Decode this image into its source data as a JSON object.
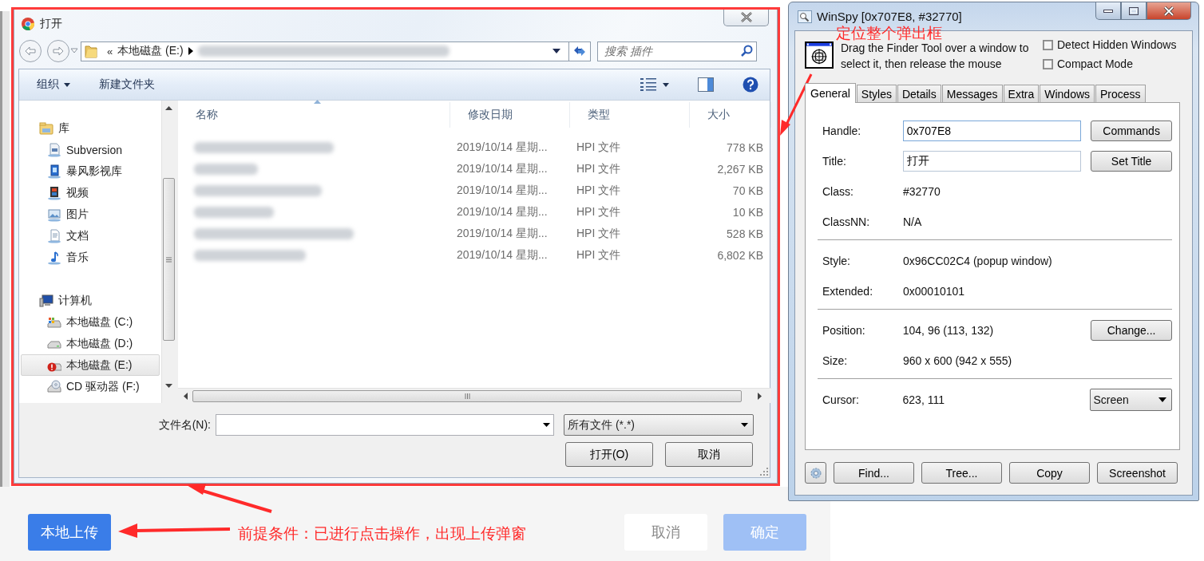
{
  "page": {
    "upload_button": "本地上传",
    "buttons": [
      {
        "label": "取消",
        "kind": "secondary",
        "disabled": false
      },
      {
        "label": "确定",
        "kind": "primary",
        "disabled": true
      }
    ]
  },
  "open_dialog": {
    "title": "打开",
    "address": {
      "prefix": "«",
      "location": "本地磁盘 (E:)"
    },
    "search": {
      "placeholder": "搜索 插件"
    },
    "toolbar": [
      {
        "label": "组织",
        "kind": "menu"
      },
      {
        "label": "新建文件夹",
        "kind": "button"
      }
    ],
    "nav_tree": [
      {
        "label": "库",
        "kind": "library",
        "selected": false,
        "children": [
          {
            "label": "Subversion",
            "kind": "svn",
            "selected": false
          },
          {
            "label": "暴风影视库",
            "kind": "media",
            "selected": false
          },
          {
            "label": "视频",
            "kind": "video",
            "selected": false
          },
          {
            "label": "图片",
            "kind": "pictures",
            "selected": false
          },
          {
            "label": "文档",
            "kind": "documents",
            "selected": false
          },
          {
            "label": "音乐",
            "kind": "music",
            "selected": false
          }
        ]
      },
      {
        "label": "计算机",
        "kind": "computer",
        "selected": false,
        "children": [
          {
            "label": "本地磁盘 (C:)",
            "kind": "drive-os",
            "selected": false
          },
          {
            "label": "本地磁盘 (D:)",
            "kind": "drive",
            "selected": false
          },
          {
            "label": "本地磁盘 (E:)",
            "kind": "drive-warning",
            "selected": true
          },
          {
            "label": "CD 驱动器 (F:)",
            "kind": "cd",
            "selected": false
          }
        ]
      }
    ],
    "columns": [
      {
        "label": "名称",
        "sorted": true
      },
      {
        "label": "修改日期",
        "sorted": false
      },
      {
        "label": "类型",
        "sorted": false
      },
      {
        "label": "大小",
        "sorted": false
      }
    ],
    "files": [
      {
        "date": "2019/10/14 星期...",
        "type": "HPI 文件",
        "size": "778 KB"
      },
      {
        "date": "2019/10/14 星期...",
        "type": "HPI 文件",
        "size": "2,267 KB"
      },
      {
        "date": "2019/10/14 星期...",
        "type": "HPI 文件",
        "size": "70 KB"
      },
      {
        "date": "2019/10/14 星期...",
        "type": "HPI 文件",
        "size": "10 KB"
      },
      {
        "date": "2019/10/14 星期...",
        "type": "HPI 文件",
        "size": "528 KB"
      },
      {
        "date": "2019/10/14 星期...",
        "type": "HPI 文件",
        "size": "6,802 KB"
      }
    ],
    "file_name": {
      "label": "文件名(N):"
    },
    "file_type": "所有文件 (*.*)",
    "buttons": [
      "打开(O)",
      "取消"
    ]
  },
  "winspy": {
    "title": "WinSpy [0x707E8, #32770]",
    "finder_hint": "Drag the Finder Tool over a window to select it, then release the mouse",
    "options": [
      {
        "label": "Detect Hidden Windows",
        "checked": false
      },
      {
        "label": "Compact Mode",
        "checked": false
      }
    ],
    "tabs": [
      {
        "label": "General",
        "selected": true
      },
      {
        "label": "Styles",
        "selected": false
      },
      {
        "label": "Details",
        "selected": false
      },
      {
        "label": "Messages",
        "selected": false
      },
      {
        "label": "Extra",
        "selected": false
      },
      {
        "label": "Windows",
        "selected": false
      },
      {
        "label": "Process",
        "selected": false
      }
    ],
    "sections": [
      [
        {
          "label": "Handle:",
          "value": "0x707E8",
          "kind": "input",
          "action": {
            "kind": "button",
            "label": "Commands"
          }
        },
        {
          "label": "Title:",
          "value": "打开",
          "kind": "input",
          "action": {
            "kind": "button",
            "label": "Set Title"
          }
        },
        {
          "label": "Class:",
          "value": "#32770",
          "kind": "text"
        },
        {
          "label": "ClassNN:",
          "value": "N/A",
          "kind": "text"
        }
      ],
      [
        {
          "label": "Style:",
          "value": "0x96CC02C4 (popup window)",
          "kind": "text"
        },
        {
          "label": "Extended:",
          "value": "0x00010101",
          "kind": "text"
        }
      ],
      [
        {
          "label": "Position:",
          "value": "104, 96 (113, 132)",
          "kind": "text",
          "action": {
            "kind": "button",
            "label": "Change..."
          }
        },
        {
          "label": "Size:",
          "value": "960 x 600 (942 x 555)",
          "kind": "text"
        }
      ],
      [
        {
          "label": "Cursor:",
          "value": "623, 111",
          "kind": "text",
          "action": {
            "kind": "dropdown",
            "label": "Screen"
          }
        }
      ]
    ],
    "footer_buttons": [
      "Find...",
      "Tree...",
      "Copy",
      "Screenshot"
    ]
  },
  "annotations": [
    {
      "text": "定位整个弹出框"
    },
    {
      "text": "前提条件：已进行点击操作，出现上传弹窗"
    }
  ]
}
